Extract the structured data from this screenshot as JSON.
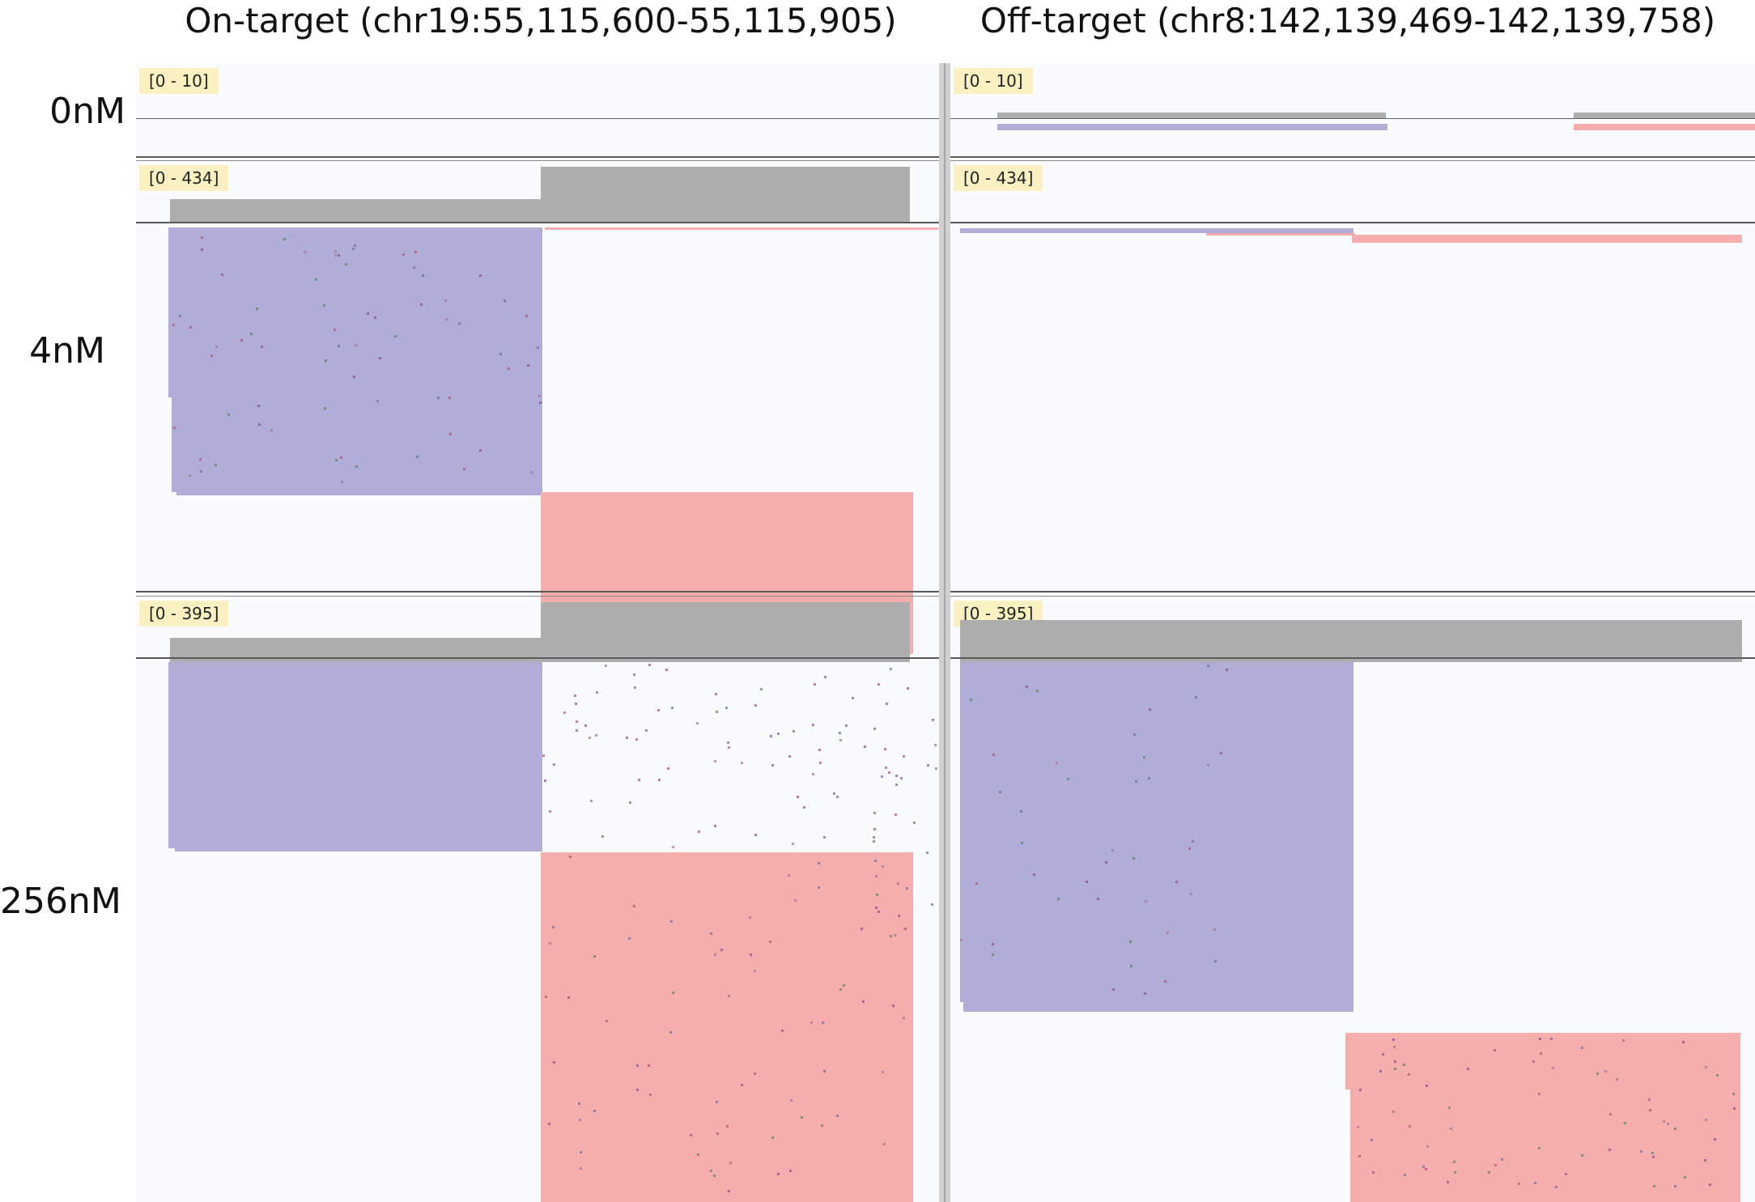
{
  "columns": {
    "on_target": "On-target (chr19:55,115,600-55,115,905)",
    "off_target": "Off-target (chr8:142,139,469-142,139,758)"
  },
  "rows": {
    "r0": "0nM",
    "r4": "4nM",
    "r256": "256nM"
  },
  "ranges": {
    "r0_on": "[0 - 10]",
    "r0_off": "[0 - 10]",
    "r4_on": "[0 - 434]",
    "r4_off": "[0 - 434]",
    "r256_on": "[0 - 395]",
    "r256_off": "[0 - 395]"
  },
  "colors": {
    "coverage": "#adadad",
    "forward_strand": "#b0aed8",
    "reverse_strand": "#f5adae",
    "range_badge": "#fbf0c2",
    "panel_bg": "#fafbfd"
  }
}
